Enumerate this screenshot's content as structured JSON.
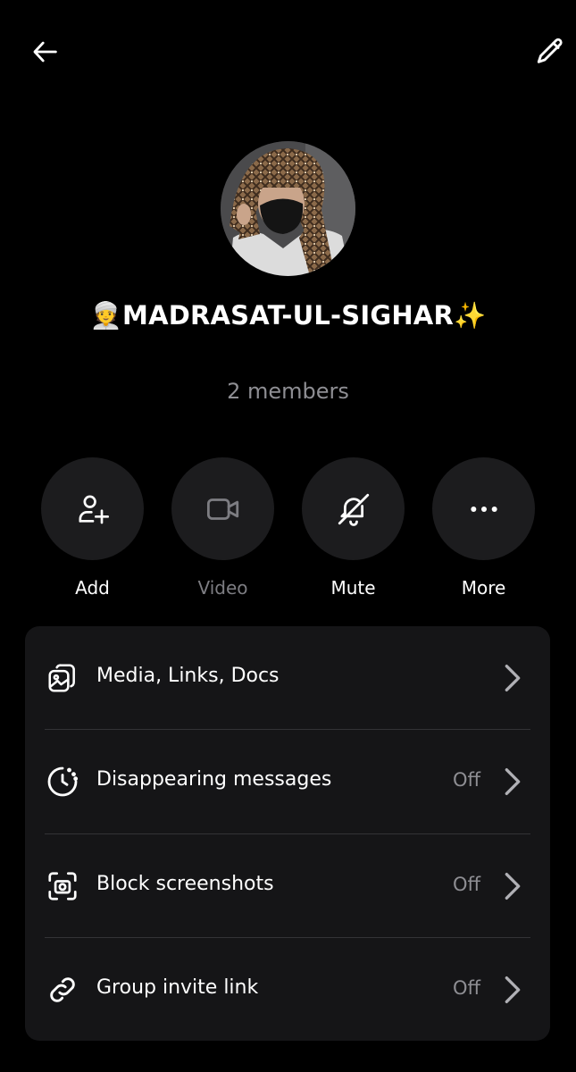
{
  "header": {
    "back_icon": "arrow-left-icon",
    "edit_icon": "pencil-icon"
  },
  "group": {
    "name": "👳MADRASAT-UL-SIGHAR✨",
    "members": "2 members"
  },
  "actions": [
    {
      "label": "Add",
      "icon": "add-user-icon",
      "enabled": true
    },
    {
      "label": "Video",
      "icon": "video-camera-icon",
      "enabled": false
    },
    {
      "label": "Mute",
      "icon": "bell-off-icon",
      "enabled": true
    },
    {
      "label": "More",
      "icon": "more-dots-icon",
      "enabled": true
    }
  ],
  "settings": [
    {
      "label": "Media, Links, Docs",
      "value": "",
      "icon": "media-icon"
    },
    {
      "label": "Disappearing messages",
      "value": "Off",
      "icon": "timer-icon"
    },
    {
      "label": "Block screenshots",
      "value": "Off",
      "icon": "screenshot-icon"
    },
    {
      "label": "Group invite link",
      "value": "Off",
      "icon": "link-icon"
    }
  ],
  "colors": {
    "background": "#000000",
    "panel": "#151517",
    "button_circle": "#1c1c1e",
    "secondary_text": "#8e8e93"
  }
}
